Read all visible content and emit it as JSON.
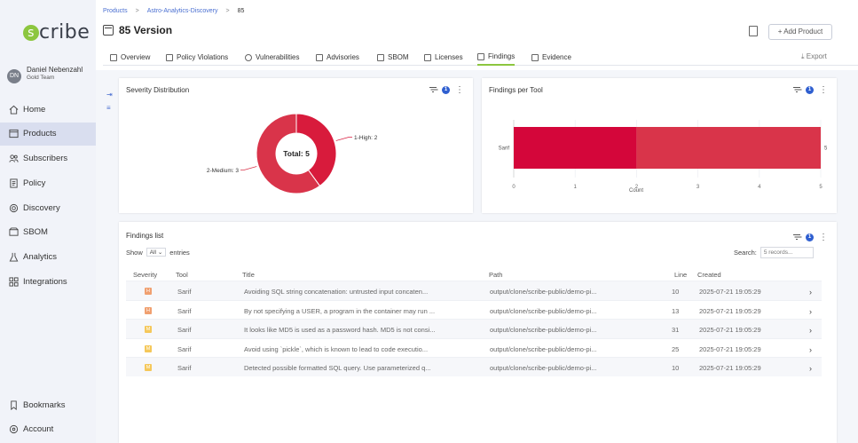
{
  "app": {
    "logo_text": "cribe",
    "logo_letter": "s"
  },
  "user": {
    "initials": "DN",
    "name": "Daniel Nebenzahl",
    "team": "Gold Team"
  },
  "nav": {
    "items": [
      {
        "label": "Home",
        "icon": "home-icon",
        "active": false
      },
      {
        "label": "Products",
        "icon": "products-icon",
        "active": true
      },
      {
        "label": "Subscribers",
        "icon": "subscribers-icon",
        "active": false
      },
      {
        "label": "Policy",
        "icon": "policy-icon",
        "active": false
      },
      {
        "label": "Discovery",
        "icon": "discovery-icon",
        "active": false
      },
      {
        "label": "SBOM",
        "icon": "sbom-icon",
        "active": false
      },
      {
        "label": "Analytics",
        "icon": "analytics-icon",
        "active": false
      },
      {
        "label": "Integrations",
        "icon": "integrations-icon",
        "active": false
      }
    ],
    "bottom": [
      {
        "label": "Bookmarks",
        "icon": "bookmark-icon"
      },
      {
        "label": "Account",
        "icon": "account-icon"
      }
    ]
  },
  "breadcrumb": {
    "items": [
      "Products",
      "Astro-Analytics-Discovery",
      "85"
    ],
    "separator": ">"
  },
  "header": {
    "title": "85 Version",
    "add_button": "+ Add Product",
    "export_label": "Export"
  },
  "tabs": [
    {
      "label": "Overview",
      "active": false
    },
    {
      "label": "Policy Violations",
      "active": false
    },
    {
      "label": "Vulnerabilities",
      "active": false
    },
    {
      "label": "Advisories",
      "active": false
    },
    {
      "label": "SBOM",
      "active": false
    },
    {
      "label": "Licenses",
      "active": false
    },
    {
      "label": "Findings",
      "active": true
    },
    {
      "label": "Evidence",
      "active": false
    }
  ],
  "severity_card": {
    "title": "Severity Distribution",
    "filter_count": "1",
    "center_label": "Total: 5",
    "slices": [
      {
        "name": "1-High",
        "value": 2,
        "color": "#d81b3c",
        "label": "1-High: 2"
      },
      {
        "name": "2-Medium",
        "value": 3,
        "color": "#d9344a",
        "label": "2-Medium: 3"
      }
    ]
  },
  "tool_card": {
    "title": "Findings per Tool",
    "filter_count": "1",
    "xlabel": "Count"
  },
  "chart_data": {
    "type": "bar",
    "orientation": "horizontal",
    "categories": [
      "Sarif"
    ],
    "series": [
      {
        "values": [
          2
        ],
        "color": "#d4063a"
      },
      {
        "values": [
          3
        ],
        "color": "#d9344a"
      }
    ],
    "total_label": "5",
    "xlabel": "Count",
    "xticks": [
      "0",
      "1",
      "2",
      "3",
      "4",
      "5"
    ],
    "xlim": [
      0,
      5
    ],
    "grid": true
  },
  "findings": {
    "title": "Findings list",
    "filter_count": "1",
    "show_label": "Show",
    "entries_value": "All",
    "entries_label": "entries",
    "search_label": "Search:",
    "search_placeholder": "5 records...",
    "columns": [
      "Severity",
      "Tool",
      "Title",
      "Path",
      "Line",
      "Created"
    ],
    "rows": [
      {
        "severity": "H",
        "sev_color": "#f0a070",
        "tool": "Sarif",
        "title": "Avoiding SQL string concatenation: untrusted input concaten...",
        "path": "output/clone/scribe-public/demo-pi...",
        "line": "10",
        "created": "2025-07-21 19:05:29"
      },
      {
        "severity": "H",
        "sev_color": "#f0a070",
        "tool": "Sarif",
        "title": "By not specifying a USER, a program in the container may run ...",
        "path": "output/clone/scribe-public/demo-pi...",
        "line": "13",
        "created": "2025-07-21 19:05:29"
      },
      {
        "severity": "M",
        "sev_color": "#f5c85a",
        "tool": "Sarif",
        "title": "It looks like MD5 is used as a password hash. MD5 is not consi...",
        "path": "output/clone/scribe-public/demo-pi...",
        "line": "31",
        "created": "2025-07-21 19:05:29"
      },
      {
        "severity": "M",
        "sev_color": "#f5c85a",
        "tool": "Sarif",
        "title": "Avoid using `pickle`, which is known to lead to code executio...",
        "path": "output/clone/scribe-public/demo-pi...",
        "line": "25",
        "created": "2025-07-21 19:05:29"
      },
      {
        "severity": "M",
        "sev_color": "#f5c85a",
        "tool": "Sarif",
        "title": "Detected possible formatted SQL query. Use parameterized q...",
        "path": "output/clone/scribe-public/demo-pi...",
        "line": "10",
        "created": "2025-07-21 19:05:29"
      }
    ]
  },
  "colors": {
    "accent": "#8cc63f",
    "link": "#4a6fd1",
    "active_nav": "#d9deef"
  }
}
